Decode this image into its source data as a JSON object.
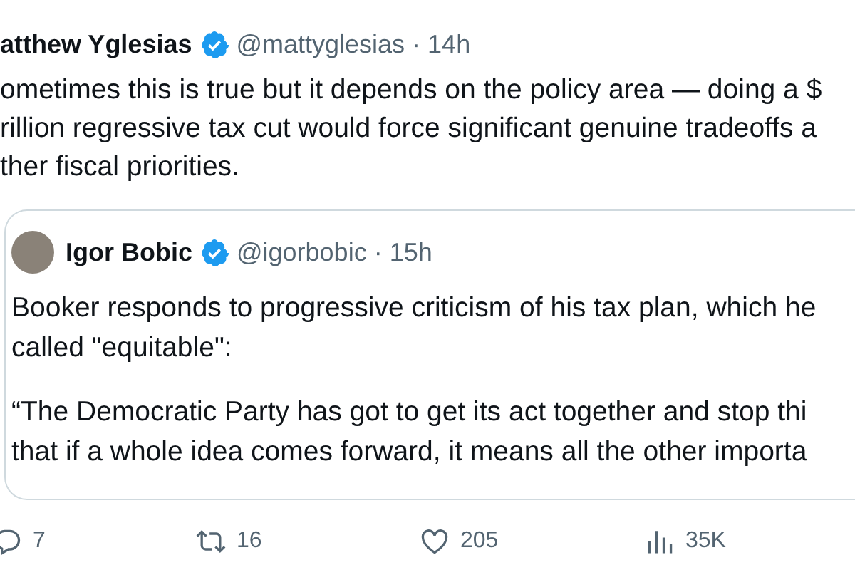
{
  "tweet": {
    "name": "atthew Yglesias",
    "verified": true,
    "handle": "@mattyglesias",
    "separator": "·",
    "time": "14h",
    "text_lines": [
      "ometimes this is true but it depends on the policy area — doing a $",
      "rillion regressive tax cut would force significant genuine tradeoffs a",
      "ther fiscal priorities."
    ]
  },
  "quoted_tweet": {
    "name": "Igor Bobic",
    "verified": true,
    "handle": "@igorbobic",
    "separator": "·",
    "time": "15h",
    "paragraphs": [
      [
        "Booker responds to progressive criticism of his tax plan, which he",
        "called \"equitable\":"
      ],
      [
        "“The Democratic Party has got to get its act together and stop thi",
        "that if a whole idea comes forward, it means all the other importa"
      ]
    ]
  },
  "actions": [
    {
      "kind": "reply",
      "count": "7"
    },
    {
      "kind": "retweet",
      "count": "16"
    },
    {
      "kind": "like",
      "count": "205"
    },
    {
      "kind": "views",
      "count": "35K"
    }
  ]
}
